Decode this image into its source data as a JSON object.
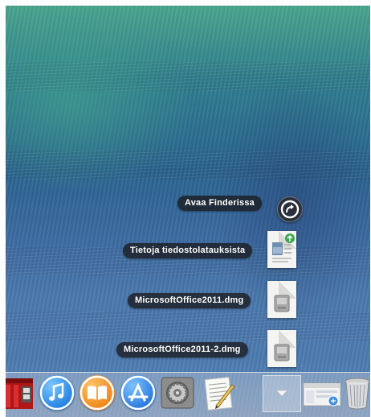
{
  "stack": {
    "open_in_finder": "Avaa Finderissa",
    "items": [
      {
        "label": "Tietoja tiedostolatauksista",
        "icon": "document-icon"
      },
      {
        "label": "MicrosoftOffice2011.dmg",
        "icon": "disk-image-icon"
      },
      {
        "label": "MicrosoftOffice2011-2.dmg",
        "icon": "disk-image-icon"
      }
    ]
  },
  "dock": {
    "apps": [
      {
        "name": "photo-booth-icon"
      },
      {
        "name": "itunes-icon"
      },
      {
        "name": "ibooks-icon"
      },
      {
        "name": "app-store-icon"
      },
      {
        "name": "system-preferences-icon"
      },
      {
        "name": "textedit-icon"
      },
      {
        "name": "downloads-stack-icon"
      },
      {
        "name": "finder-window-icon"
      },
      {
        "name": "trash-icon"
      }
    ]
  },
  "colors": {
    "pill_background": "#1c1e24",
    "itunes_blue": "#2d8ae6",
    "ibooks_orange": "#f08a1c",
    "appstore_blue": "#2f7ee0"
  }
}
